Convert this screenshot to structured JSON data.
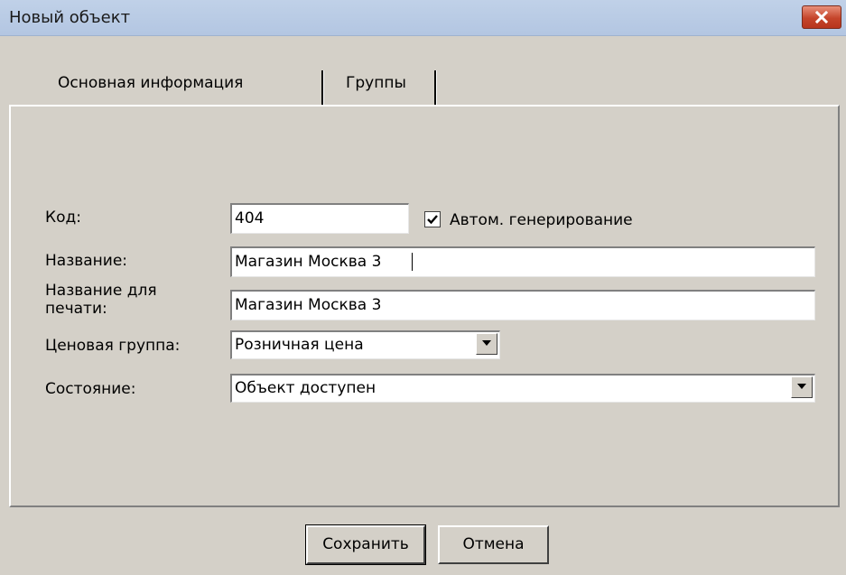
{
  "window": {
    "title": "Новый объект"
  },
  "tabs": [
    {
      "label": "Основная информация",
      "active": true
    },
    {
      "label": "Группы",
      "active": false
    }
  ],
  "form": {
    "code": {
      "label": "Код:",
      "value": "404"
    },
    "auto_generate": {
      "label": "Автом. генерирование",
      "checked": true
    },
    "name": {
      "label": "Название:",
      "value": "Магазин Москва 3"
    },
    "print_name": {
      "label_line1": "Название для",
      "label_line2": "печати:",
      "value": "Магазин Москва 3"
    },
    "price_group": {
      "label": "Ценовая группа:",
      "value": "Розничная цена"
    },
    "status": {
      "label": "Состояние:",
      "value": "Объект доступен"
    }
  },
  "buttons": {
    "save": "Сохранить",
    "cancel": "Отмена"
  },
  "colors": {
    "window_bg": "#d4d0c8",
    "titlebar": "#b3c6e2",
    "close_button": "#c5452b"
  },
  "icons": {
    "close": "close-icon",
    "dropdown": "chevron-down-icon",
    "check": "checkmark-icon"
  }
}
